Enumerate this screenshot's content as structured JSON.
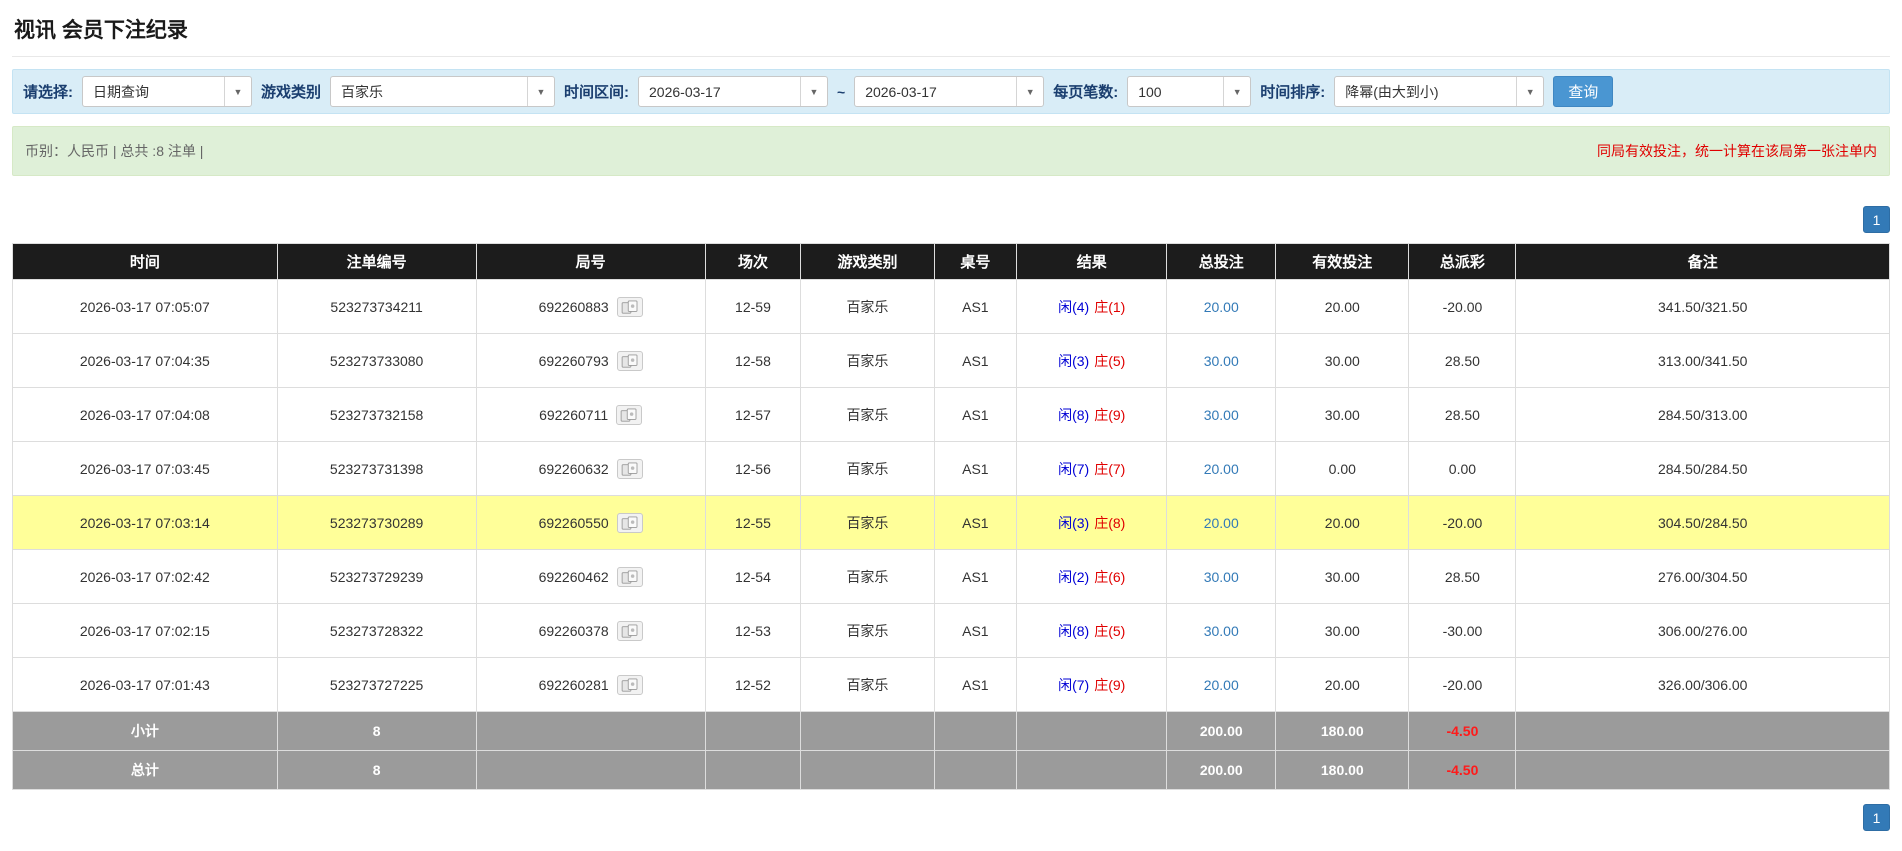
{
  "page": {
    "title": "视讯 会员下注纪录"
  },
  "filter": {
    "select_label": "请选择:",
    "select_value": "日期查询",
    "game_label": "游戏类别",
    "game_value": "百家乐",
    "range_label": "时间区间:",
    "date_from": "2026-03-17",
    "range_separator": "~",
    "date_to": "2026-03-17",
    "page_size_label": "每页笔数:",
    "page_size_value": "100",
    "sort_label": "时间排序:",
    "sort_value": "降幂(由大到小)",
    "search_button": "查询"
  },
  "summary_bar": {
    "left_text": "币别：人民币 | 总共 :8 注单 |",
    "right_notice": "同局有效投注，统一计算在该局第一张注单内"
  },
  "pagination": {
    "current_page": "1"
  },
  "table": {
    "headers": [
      "时间",
      "注单编号",
      "局号",
      "场次",
      "游戏类别",
      "桌号",
      "结果",
      "总投注",
      "有效投注",
      "总派彩",
      "备注"
    ],
    "rows": [
      {
        "time": "2026-03-17 07:05:07",
        "bet_id": "523273734211",
        "round": "692260883",
        "session": "12-59",
        "game": "百家乐",
        "table_no": "AS1",
        "player": "闲(4)",
        "banker": "庄(1)",
        "total_bet": "20.00",
        "valid_bet": "20.00",
        "payout": "-20.00",
        "note": "341.50/321.50"
      },
      {
        "time": "2026-03-17 07:04:35",
        "bet_id": "523273733080",
        "round": "692260793",
        "session": "12-58",
        "game": "百家乐",
        "table_no": "AS1",
        "player": "闲(3)",
        "banker": "庄(5)",
        "total_bet": "30.00",
        "valid_bet": "30.00",
        "payout": "28.50",
        "note": "313.00/341.50"
      },
      {
        "time": "2026-03-17 07:04:08",
        "bet_id": "523273732158",
        "round": "692260711",
        "session": "12-57",
        "game": "百家乐",
        "table_no": "AS1",
        "player": "闲(8)",
        "banker": "庄(9)",
        "total_bet": "30.00",
        "valid_bet": "30.00",
        "payout": "28.50",
        "note": "284.50/313.00"
      },
      {
        "time": "2026-03-17 07:03:45",
        "bet_id": "523273731398",
        "round": "692260632",
        "session": "12-56",
        "game": "百家乐",
        "table_no": "AS1",
        "player": "闲(7)",
        "banker": "庄(7)",
        "total_bet": "20.00",
        "valid_bet": "0.00",
        "payout": "0.00",
        "note": "284.50/284.50"
      },
      {
        "time": "2026-03-17 07:03:14",
        "bet_id": "523273730289",
        "round": "692260550",
        "session": "12-55",
        "game": "百家乐",
        "table_no": "AS1",
        "player": "闲(3)",
        "banker": "庄(8)",
        "total_bet": "20.00",
        "valid_bet": "20.00",
        "payout": "-20.00",
        "note": "304.50/284.50"
      },
      {
        "time": "2026-03-17 07:02:42",
        "bet_id": "523273729239",
        "round": "692260462",
        "session": "12-54",
        "game": "百家乐",
        "table_no": "AS1",
        "player": "闲(2)",
        "banker": "庄(6)",
        "total_bet": "30.00",
        "valid_bet": "30.00",
        "payout": "28.50",
        "note": "276.00/304.50"
      },
      {
        "time": "2026-03-17 07:02:15",
        "bet_id": "523273728322",
        "round": "692260378",
        "session": "12-53",
        "game": "百家乐",
        "table_no": "AS1",
        "player": "闲(8)",
        "banker": "庄(5)",
        "total_bet": "30.00",
        "valid_bet": "30.00",
        "payout": "-30.00",
        "note": "306.00/276.00"
      },
      {
        "time": "2026-03-17 07:01:43",
        "bet_id": "523273727225",
        "round": "692260281",
        "session": "12-52",
        "game": "百家乐",
        "table_no": "AS1",
        "player": "闲(7)",
        "banker": "庄(9)",
        "total_bet": "20.00",
        "valid_bet": "20.00",
        "payout": "-20.00",
        "note": "326.00/306.00"
      }
    ],
    "subtotal": {
      "label": "小计",
      "count": "8",
      "total_bet": "200.00",
      "valid_bet": "180.00",
      "payout": "-4.50"
    },
    "total": {
      "label": "总计",
      "count": "8",
      "total_bet": "200.00",
      "valid_bet": "180.00",
      "payout": "-4.50"
    }
  },
  "colors": {
    "accent_blue": "#337ab7",
    "negative_red": "#ff0000",
    "highlight_yellow": "#ffff99",
    "player_blue": "#0000d5",
    "banker_red": "#e00000"
  }
}
